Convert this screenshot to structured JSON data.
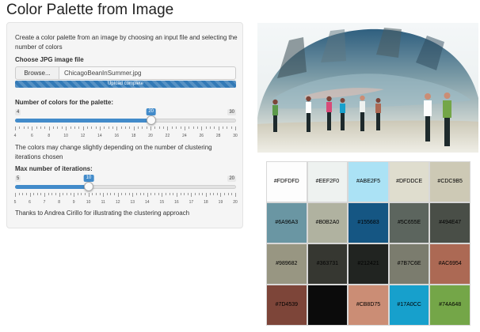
{
  "title": "Color Palette from Image",
  "sidebar": {
    "description": "Create a color palette from an image by choosing an input file and selecting the number of colors",
    "file_label": "Choose JPG image file",
    "browse_label": "Browse...",
    "file_name": "ChicagoBeanInSummer.jpg",
    "upload_status": "Upload complete",
    "upload_progress_percent": 100,
    "colors_slider": {
      "label": "Number of colors for the palette:",
      "min": 4,
      "max": 30,
      "value": 20,
      "ticks": [
        "4",
        "6",
        "8",
        "10",
        "12",
        "14",
        "16",
        "18",
        "20",
        "22",
        "24",
        "26",
        "28",
        "30"
      ]
    },
    "note": "The colors may change slightly depending on the number of clustering iterations chosen",
    "iterations_slider": {
      "label": "Max number of iterations:",
      "min": 5,
      "max": 20,
      "value": 10,
      "ticks": [
        "5",
        "6",
        "7",
        "8",
        "9",
        "10",
        "11",
        "12",
        "13",
        "14",
        "15",
        "16",
        "17",
        "18",
        "19",
        "20"
      ]
    },
    "thanks": "Thanks to Andrea Cirillo for illustrating the clustering approach"
  },
  "image": {
    "subject": "Chicago Bean (Cloud Gate) in summer with visitors"
  },
  "palette": [
    {
      "hex": "#FDFDFD",
      "label": "#FDFDFD"
    },
    {
      "hex": "#EEF2F0",
      "label": "#EEF2F0"
    },
    {
      "hex": "#ABE2F5",
      "label": "#ABE2F5"
    },
    {
      "hex": "#DFDDCE",
      "label": "#DFDDCE"
    },
    {
      "hex": "#CDC9B5",
      "label": "#CDC9B5"
    },
    {
      "hex": "#6A96A3",
      "label": "#6A96A3"
    },
    {
      "hex": "#B0B2A0",
      "label": "#B0B2A0"
    },
    {
      "hex": "#155683",
      "label": "#155683"
    },
    {
      "hex": "#5C655E",
      "label": "#5C655E"
    },
    {
      "hex": "#494E47",
      "label": "#494E47"
    },
    {
      "hex": "#989682",
      "label": "#989682"
    },
    {
      "hex": "#363731",
      "label": "#363731"
    },
    {
      "hex": "#212421",
      "label": "#212421"
    },
    {
      "hex": "#7B7C6E",
      "label": "#7B7C6E"
    },
    {
      "hex": "#AC6954",
      "label": "#AC6954"
    },
    {
      "hex": "#7D4539",
      "label": "#7D4539"
    },
    {
      "hex": "#0B0B0B",
      "label": ""
    },
    {
      "hex": "#CB8D75",
      "label": "#CB8D75"
    },
    {
      "hex": "#17A0CC",
      "label": "#17A0CC"
    },
    {
      "hex": "#74A648",
      "label": "#74A648"
    }
  ]
}
